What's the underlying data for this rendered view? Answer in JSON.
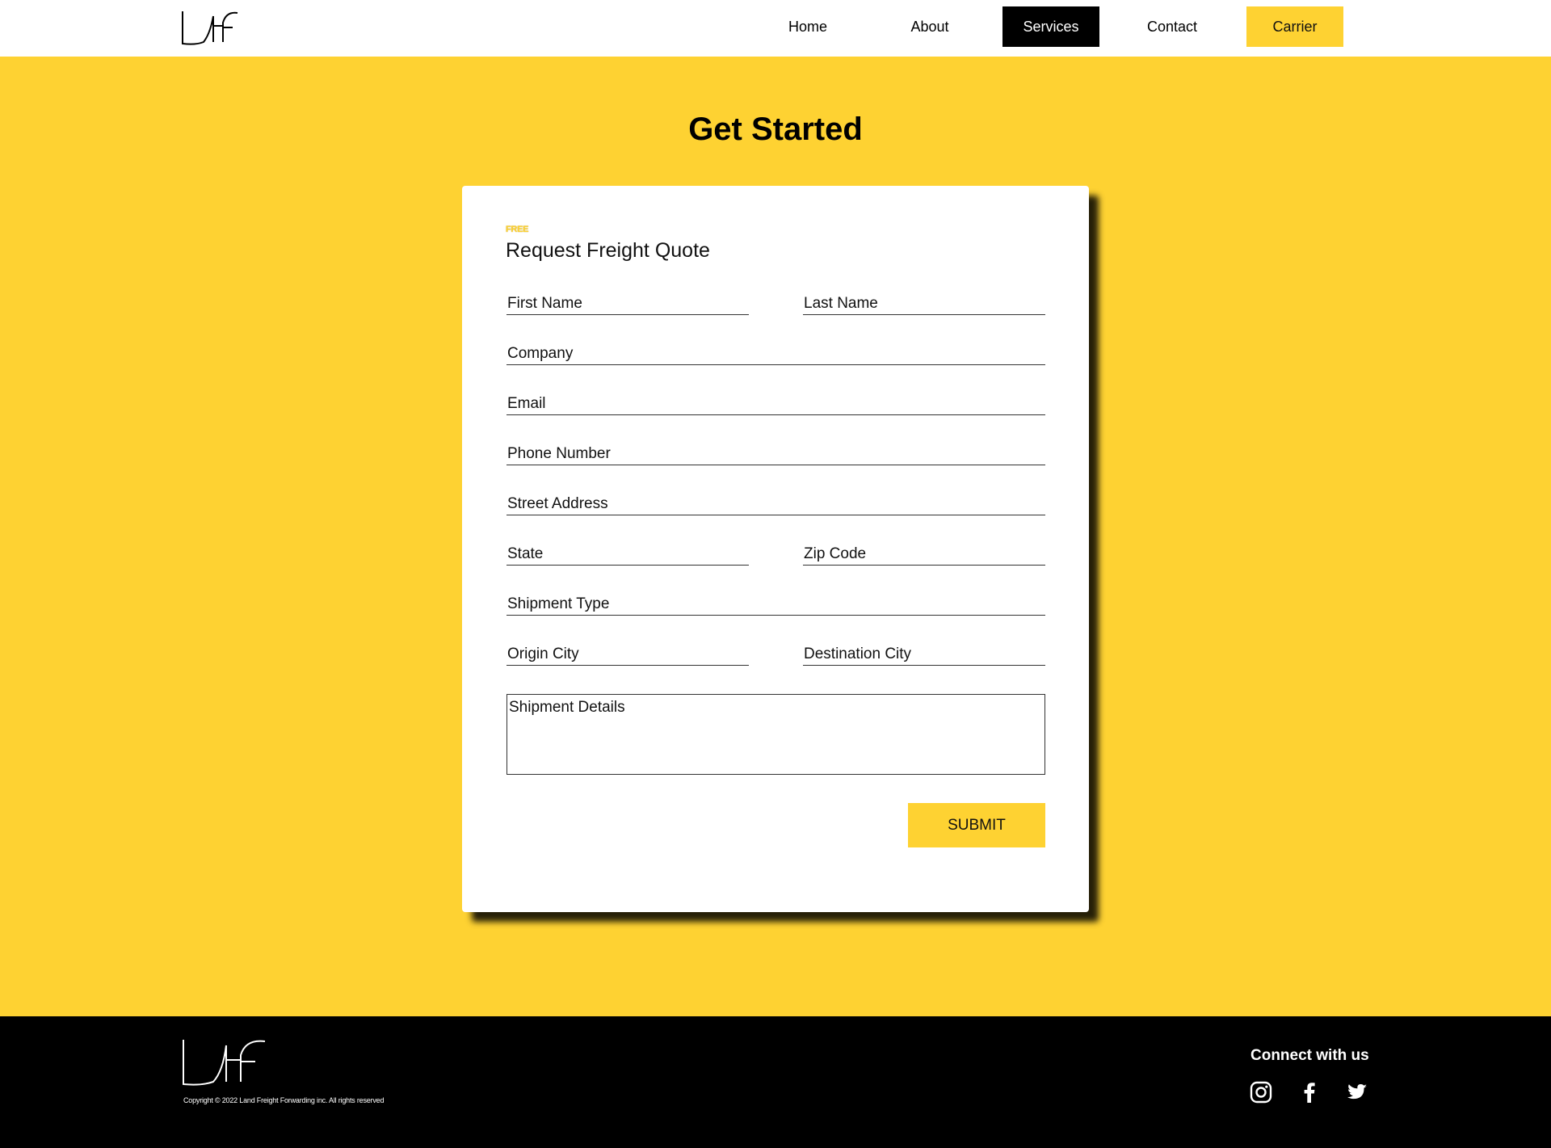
{
  "header": {
    "nav": {
      "home": "Home",
      "about": "About",
      "services": "Services",
      "contact": "Contact",
      "carrier": "Carrier"
    }
  },
  "main": {
    "title": "Get Started"
  },
  "form": {
    "badge": "FREE",
    "title": "Request Freight Quote",
    "fields": {
      "first_name": "First Name",
      "last_name": "Last Name",
      "company": "Company",
      "email": "Email",
      "phone": "Phone Number",
      "street": "Street Address",
      "state": "State",
      "zip": "Zip Code",
      "shipment_type": "Shipment Type",
      "origin_city": "Origin City",
      "destination_city": "Destination City",
      "shipment_details": "Shipment Details"
    },
    "submit_label": "SUBMIT"
  },
  "footer": {
    "copyright": "Copyright © 2022 Land Freight Forwarding inc. All rights reserved",
    "connect_label": "Connect with us",
    "social_icons": [
      "instagram-icon",
      "facebook-icon",
      "twitter-icon"
    ]
  },
  "colors": {
    "accent": "#FED232",
    "dark": "#000000",
    "white": "#FFFFFF"
  }
}
